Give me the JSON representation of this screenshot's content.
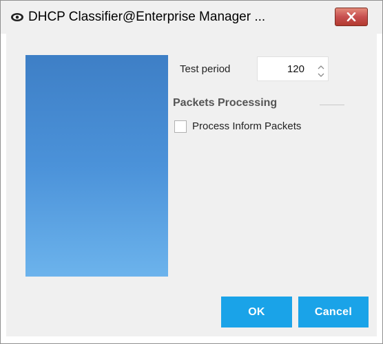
{
  "window": {
    "title": "DHCP Classifier@Enterprise Manager ..."
  },
  "form": {
    "test_period_label": "Test period",
    "test_period_value": "120",
    "section_title": "Packets Processing",
    "process_inform_label": "Process Inform Packets",
    "process_inform_checked": false
  },
  "buttons": {
    "ok": "OK",
    "cancel": "Cancel"
  },
  "colors": {
    "accent": "#1aa3e8",
    "close": "#c75050",
    "image_top": "#3e7fc6",
    "image_bottom": "#6cb3ec"
  },
  "icons": {
    "app": "eye-icon",
    "close": "close-icon",
    "spin_up": "chevron-up-icon",
    "spin_down": "chevron-down-icon"
  }
}
